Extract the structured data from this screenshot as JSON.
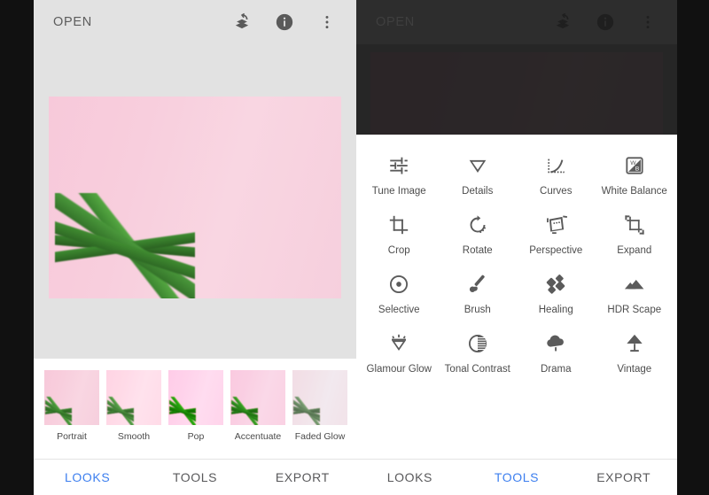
{
  "app": {
    "left": {
      "appbar": {
        "title": "OPEN"
      },
      "nav": [
        {
          "label": "LOOKS",
          "active": true
        },
        {
          "label": "TOOLS",
          "active": false
        },
        {
          "label": "EXPORT",
          "active": false
        }
      ]
    },
    "right": {
      "appbar": {
        "title": "OPEN"
      },
      "nav": [
        {
          "label": "LOOKS",
          "active": false
        },
        {
          "label": "TOOLS",
          "active": true
        },
        {
          "label": "EXPORT",
          "active": false
        }
      ]
    },
    "appbar_icons": [
      {
        "name": "undo-stack-icon",
        "label": "Undo"
      },
      {
        "name": "info-icon",
        "label": "Info"
      },
      {
        "name": "overflow-menu-icon",
        "label": "More options"
      }
    ]
  },
  "looks": [
    {
      "label": "Portrait"
    },
    {
      "label": "Smooth"
    },
    {
      "label": "Pop"
    },
    {
      "label": "Accentuate"
    },
    {
      "label": "Faded Glow"
    }
  ],
  "tools": [
    {
      "label": "Tune Image",
      "icon": "sliders-icon"
    },
    {
      "label": "Details",
      "icon": "triangle-down-icon"
    },
    {
      "label": "Curves",
      "icon": "curve-icon"
    },
    {
      "label": "White Balance",
      "icon": "white-balance-icon"
    },
    {
      "label": "Crop",
      "icon": "crop-icon"
    },
    {
      "label": "Rotate",
      "icon": "rotate-icon"
    },
    {
      "label": "Perspective",
      "icon": "perspective-icon"
    },
    {
      "label": "Expand",
      "icon": "expand-icon"
    },
    {
      "label": "Selective",
      "icon": "selective-icon"
    },
    {
      "label": "Brush",
      "icon": "brush-icon"
    },
    {
      "label": "Healing",
      "icon": "healing-icon"
    },
    {
      "label": "HDR Scape",
      "icon": "mountains-icon"
    },
    {
      "label": "Glamour Glow",
      "icon": "diamond-icon"
    },
    {
      "label": "Tonal Contrast",
      "icon": "contrast-circle-icon"
    },
    {
      "label": "Drama",
      "icon": "cloud-icon"
    },
    {
      "label": "Vintage",
      "icon": "lamp-icon"
    }
  ],
  "colors": {
    "accent": "#3d7fef",
    "panel_bg": "#e2e2e2",
    "sheet_bg": "#ffffff",
    "scrim": "#262626",
    "letterbox": "#111111"
  }
}
